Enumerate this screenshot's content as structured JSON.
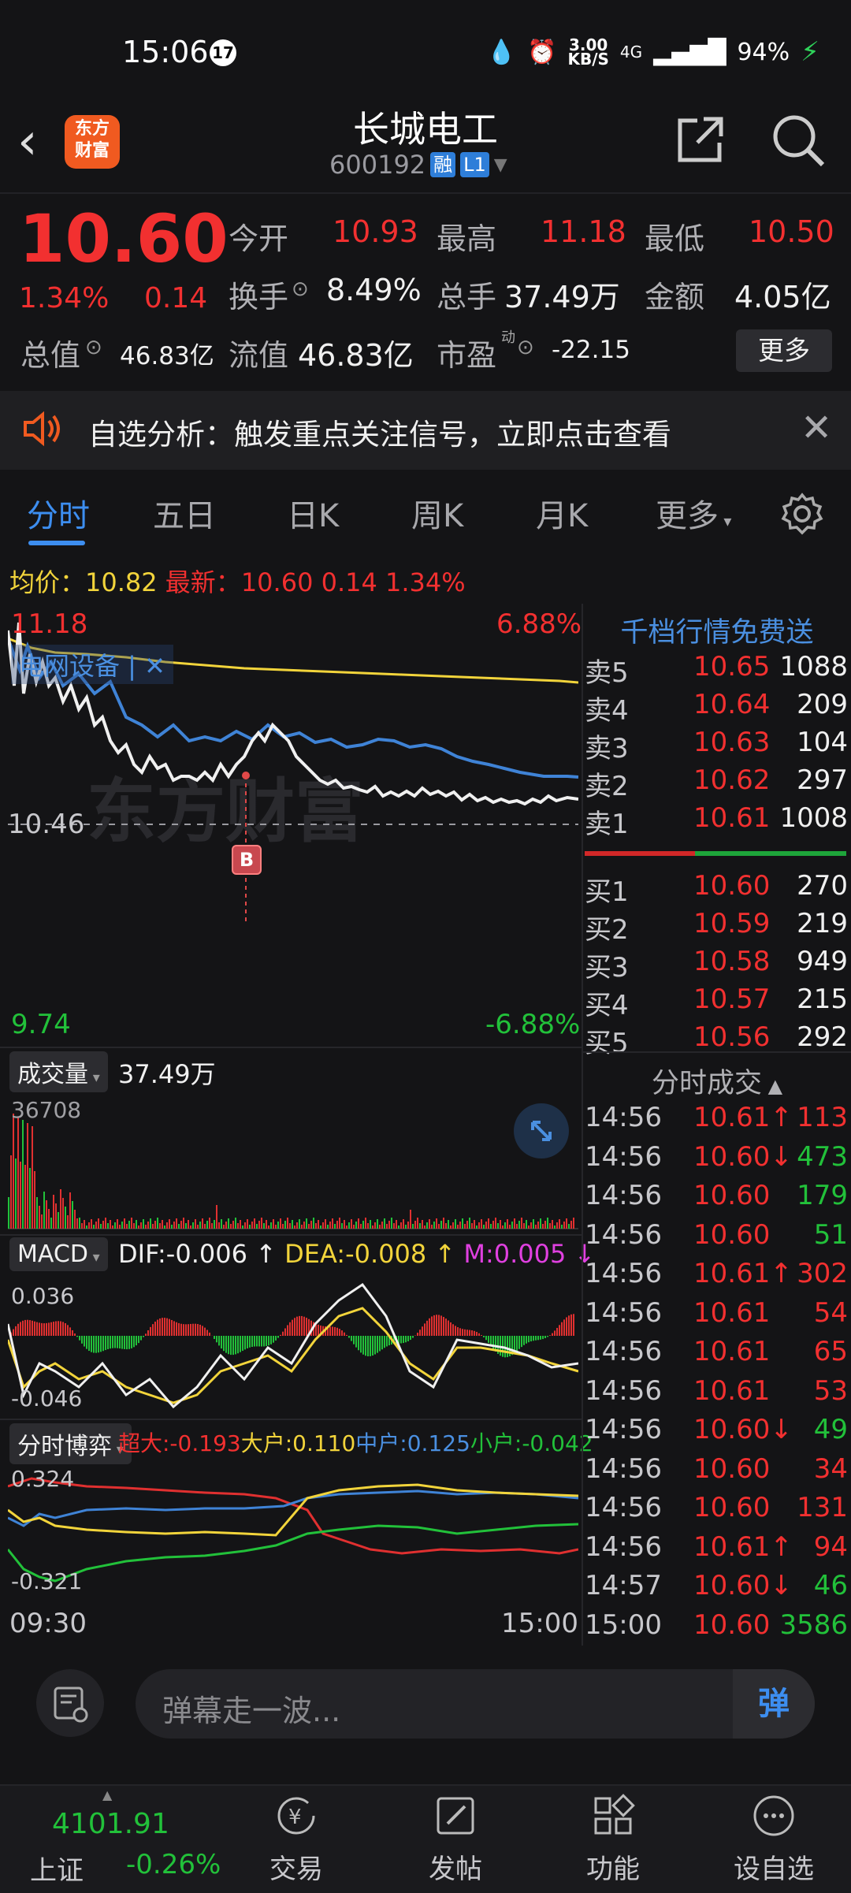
{
  "status": {
    "time": "15:06",
    "notif_count": "17",
    "net_speed": "3.00",
    "net_unit": "KB/S",
    "signal": "4G",
    "battery": "94%"
  },
  "header": {
    "logo_line1": "东方",
    "logo_line2": "财富",
    "name": "长城电工",
    "code": "600192",
    "tag1": "融",
    "tag2": "L1"
  },
  "quote": {
    "price": "10.60",
    "pct": "1.34%",
    "chg": "0.14",
    "open_label": "今开",
    "open": "10.93",
    "high_label": "最高",
    "high": "11.18",
    "low_label": "最低",
    "low": "10.50",
    "turnover_label": "换手",
    "turnover": "8.49%",
    "volume_label": "总手",
    "volume": "37.49万",
    "amount_label": "金额",
    "amount": "4.05亿",
    "mktcap_label": "总值",
    "mktcap": "46.83亿",
    "float_label": "流值",
    "float": "46.83亿",
    "pe_label": "市盈",
    "pe_sup": "动",
    "pe": "-22.15",
    "more": "更多"
  },
  "banner": {
    "text": "自选分析：触发重点关注信号，立即点击查看"
  },
  "tabs": [
    "分时",
    "五日",
    "日K",
    "周K",
    "月K",
    "更多"
  ],
  "avgbar": {
    "avg_label": "均价：",
    "avg": "10.82",
    "last_label": "最新：",
    "last": "10.60",
    "chg": "0.14",
    "pct": "1.34%"
  },
  "chart": {
    "price_high": "11.18",
    "price_mid": "10.46",
    "price_low": "9.74",
    "pct_high": "6.88%",
    "pct_low": "-6.88%",
    "sector": "电网设备 | ✕",
    "buy_marker": "B",
    "watermark": "东方财富",
    "vol_label": "成交量",
    "vol_total": "37.49万",
    "vol_max": "36708",
    "macd_label": "MACD",
    "dif": "DIF:-0.006",
    "dea": "DEA:-0.008",
    "m": "M:0.005",
    "macd_hi": "0.036",
    "macd_lo": "-0.046",
    "flow_label": "分时博弈",
    "super": "超大:-0.193",
    "large": "大户:0.110",
    "mid": "中户:0.125",
    "small": "小户:-0.042",
    "flow_hi": "0.324",
    "flow_lo": "-0.321",
    "t_start": "09:30",
    "t_end": "15:00"
  },
  "orderbook": {
    "header": "千档行情免费送",
    "asks": [
      {
        "label": "卖5",
        "price": "10.65",
        "vol": "1088"
      },
      {
        "label": "卖4",
        "price": "10.64",
        "vol": "209"
      },
      {
        "label": "卖3",
        "price": "10.63",
        "vol": "104"
      },
      {
        "label": "卖2",
        "price": "10.62",
        "vol": "297"
      },
      {
        "label": "卖1",
        "price": "10.61",
        "vol": "1008"
      }
    ],
    "bids": [
      {
        "label": "买1",
        "price": "10.60",
        "vol": "270"
      },
      {
        "label": "买2",
        "price": "10.59",
        "vol": "219"
      },
      {
        "label": "买3",
        "price": "10.58",
        "vol": "949"
      },
      {
        "label": "买4",
        "price": "10.57",
        "vol": "215"
      },
      {
        "label": "买5",
        "price": "10.56",
        "vol": "292"
      }
    ]
  },
  "trades": {
    "header": "分时成交",
    "rows": [
      {
        "t": "14:56",
        "p": "10.61↑",
        "v": "113",
        "pc": "#f23030",
        "vc": "#f23030"
      },
      {
        "t": "14:56",
        "p": "10.60↓",
        "v": "473",
        "pc": "#f23030",
        "vc": "#22c13a"
      },
      {
        "t": "14:56",
        "p": "10.60",
        "v": "179",
        "pc": "#f23030",
        "vc": "#22c13a"
      },
      {
        "t": "14:56",
        "p": "10.60",
        "v": "51",
        "pc": "#f23030",
        "vc": "#22c13a"
      },
      {
        "t": "14:56",
        "p": "10.61↑",
        "v": "302",
        "pc": "#f23030",
        "vc": "#f23030"
      },
      {
        "t": "14:56",
        "p": "10.61",
        "v": "54",
        "pc": "#f23030",
        "vc": "#f23030"
      },
      {
        "t": "14:56",
        "p": "10.61",
        "v": "65",
        "pc": "#f23030",
        "vc": "#f23030"
      },
      {
        "t": "14:56",
        "p": "10.61",
        "v": "53",
        "pc": "#f23030",
        "vc": "#f23030"
      },
      {
        "t": "14:56",
        "p": "10.60↓",
        "v": "49",
        "pc": "#f23030",
        "vc": "#22c13a"
      },
      {
        "t": "14:56",
        "p": "10.60",
        "v": "34",
        "pc": "#f23030",
        "vc": "#f23030"
      },
      {
        "t": "14:56",
        "p": "10.60",
        "v": "131",
        "pc": "#f23030",
        "vc": "#f23030"
      },
      {
        "t": "14:56",
        "p": "10.61↑",
        "v": "94",
        "pc": "#f23030",
        "vc": "#f23030"
      },
      {
        "t": "14:57",
        "p": "10.60↓",
        "v": "46",
        "pc": "#f23030",
        "vc": "#22c13a"
      },
      {
        "t": "15:00",
        "p": "10.60",
        "v": "3586",
        "pc": "#f23030",
        "vc": "#22c13a"
      }
    ]
  },
  "comment": {
    "placeholder": "弹幕走一波...",
    "send": "弹"
  },
  "bottom_nav": {
    "index_value": "4101.91",
    "index_name": "上证",
    "index_chg": "-0.26%",
    "items": [
      "交易",
      "发帖",
      "功能",
      "设自选"
    ]
  },
  "colors": {
    "up": "#f23030",
    "down": "#22c13a",
    "accent": "#3d8ef0",
    "avg": "#f2d43b"
  }
}
